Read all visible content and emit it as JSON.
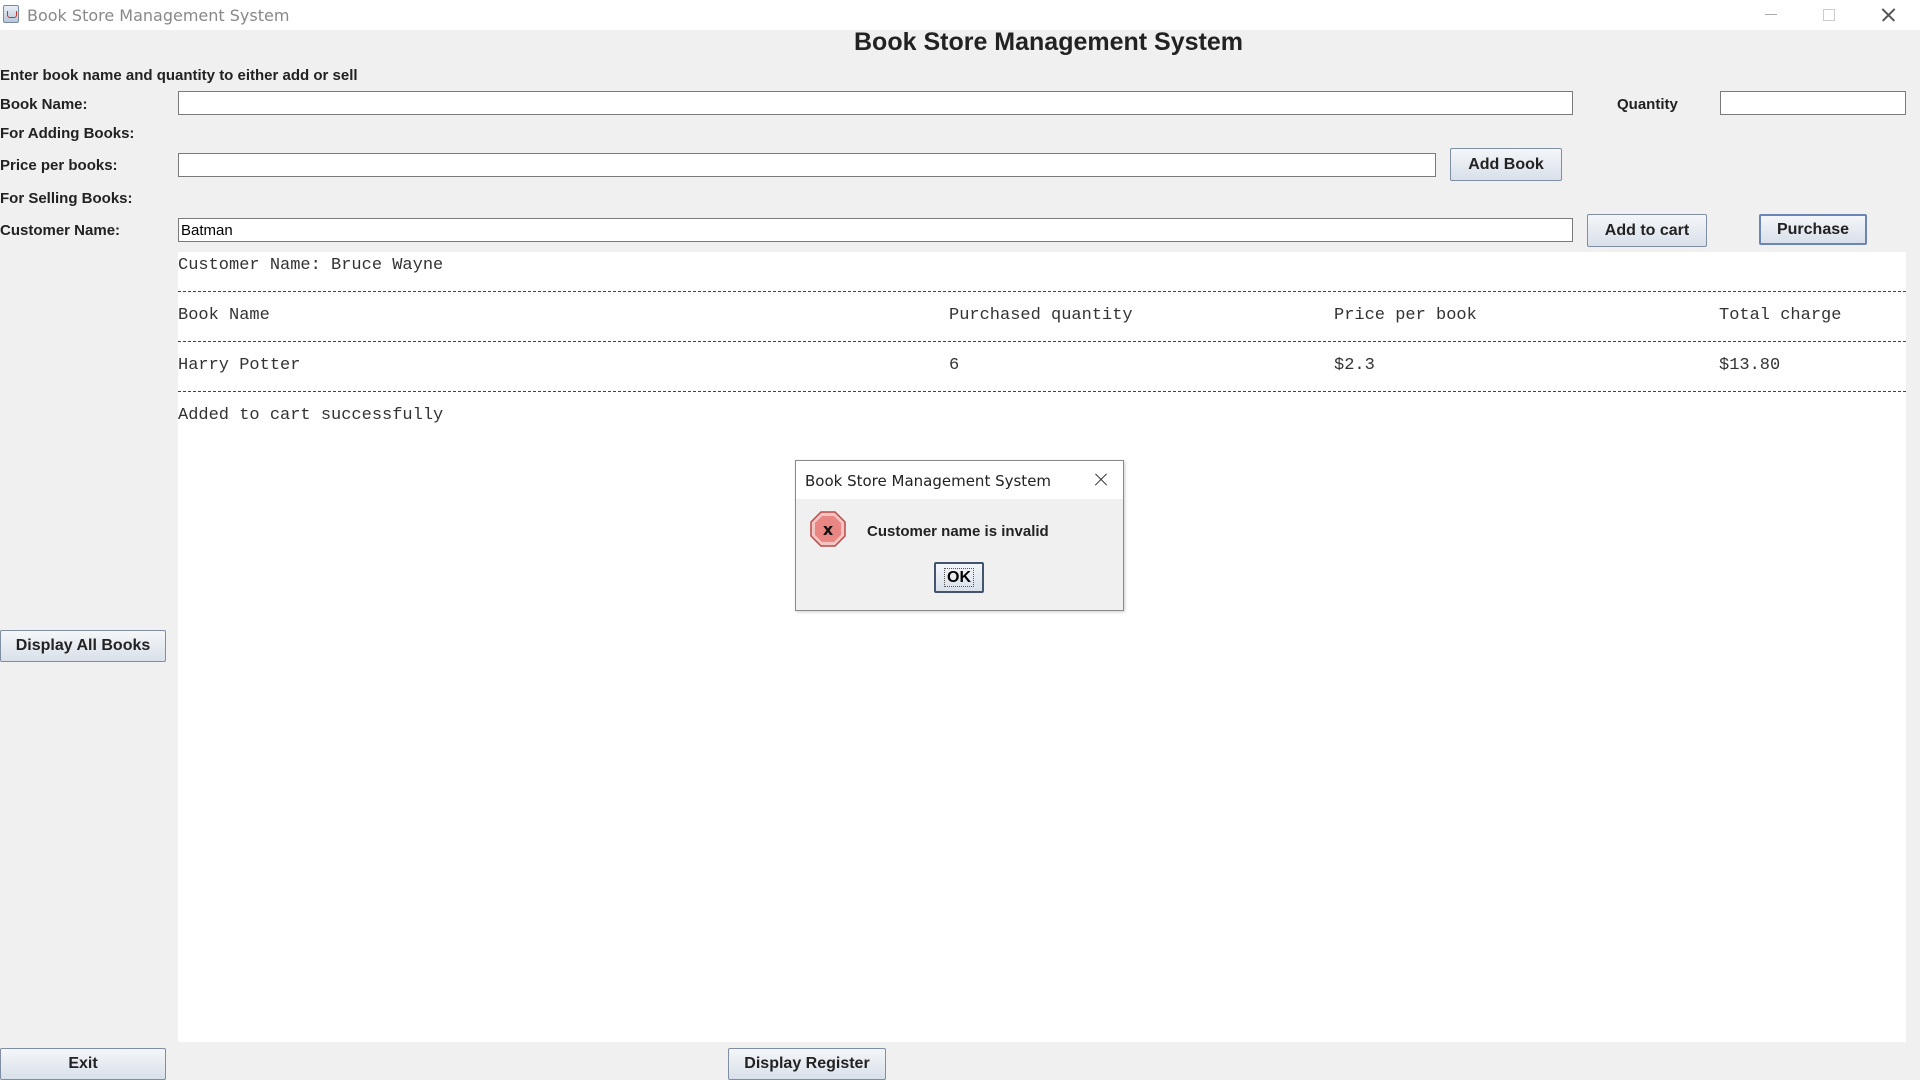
{
  "window": {
    "title": "Book Store Management System"
  },
  "heading": "Book Store Management System",
  "instruction": "Enter book name and quantity to either add or sell",
  "labels": {
    "book_name": "Book Name:",
    "quantity": "Quantity",
    "for_adding": "For Adding Books:",
    "price_per_books": "Price per books:",
    "for_selling": "For Selling Books:",
    "customer_name": "Customer Name:"
  },
  "inputs": {
    "book_name": "",
    "quantity": "",
    "price": "",
    "customer_name": "Batman"
  },
  "buttons": {
    "add_book": "Add Book",
    "add_to_cart": "Add to cart",
    "purchase": "Purchase",
    "display_all_books": "Display All Books",
    "exit": "Exit",
    "display_register": "Display Register"
  },
  "output": {
    "customer_line": "Customer Name: Bruce Wayne",
    "headers": [
      "Book Name",
      "Purchased quantity",
      "Price per book",
      "Total charge"
    ],
    "rows": [
      {
        "book": "Harry Potter",
        "quantity": "6",
        "price": "$2.3",
        "total": "$13.80"
      }
    ],
    "status": "Added to cart successfully"
  },
  "dialog": {
    "title": "Book Store Management System",
    "icon": "error-icon",
    "message": "Customer name is invalid",
    "ok": "OK"
  },
  "colors": {
    "background": "#f0f0f0",
    "button_gradient_top": "#f4f6f9",
    "button_gradient_bottom": "#d9e0ea",
    "error_icon": "#d9534f"
  }
}
